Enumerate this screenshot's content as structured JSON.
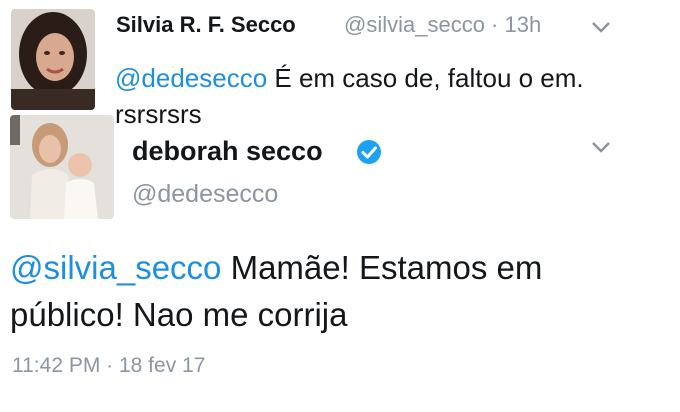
{
  "reply": {
    "author_name": "Silvia R. F. Secco",
    "author_handle": "@silvia_secco",
    "separator": " · ",
    "time": "13h",
    "reply_to": "@dedesecco",
    "text": " É em caso de, faltou o em. rsrsrsrs"
  },
  "tweet": {
    "author_name": "deborah secco",
    "author_handle": "@dedesecco",
    "verified": true,
    "mention": "@silvia_secco",
    "text": " Mamãe! Estamos em público! Nao me corrija",
    "timestamp": "11:42 PM · 18 fev 17"
  },
  "icons": {
    "reply_avatar": "avatar-photo-icon",
    "main_avatar": "avatar-photo-icon",
    "verified": "verified-badge-icon",
    "chevron": "chevron-down-icon"
  },
  "colors": {
    "link": "#1d8fe0",
    "muted": "#8c96a0",
    "text": "#14171a",
    "verified": "#1da1f2"
  }
}
